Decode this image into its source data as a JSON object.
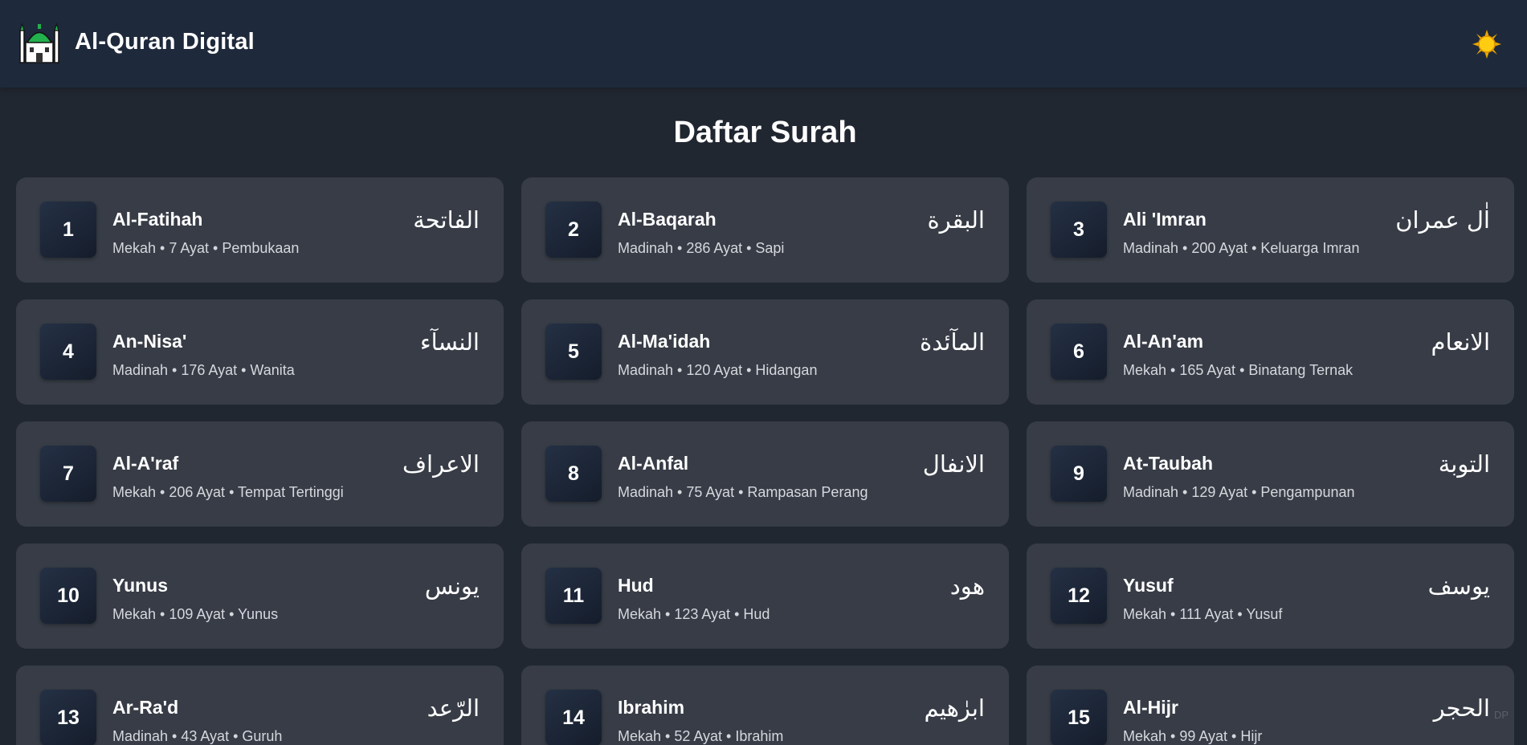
{
  "header": {
    "app_title": "Al-Quran Digital",
    "logo_icon": "mosque-icon",
    "theme_icon": "sun-icon"
  },
  "main": {
    "page_title": "Daftar Surah",
    "corner_mark": "DP"
  },
  "surahs": [
    {
      "number": "1",
      "name": "Al-Fatihah",
      "meta": "Mekah • 7 Ayat • Pembukaan",
      "arabic": "الفاتحة"
    },
    {
      "number": "2",
      "name": "Al-Baqarah",
      "meta": "Madinah • 286 Ayat • Sapi",
      "arabic": "البقرة"
    },
    {
      "number": "3",
      "name": "Ali 'Imran",
      "meta": "Madinah • 200 Ayat • Keluarga Imran",
      "arabic": "اٰل عمران"
    },
    {
      "number": "4",
      "name": "An-Nisa'",
      "meta": "Madinah • 176 Ayat • Wanita",
      "arabic": "النسآء"
    },
    {
      "number": "5",
      "name": "Al-Ma'idah",
      "meta": "Madinah • 120 Ayat • Hidangan",
      "arabic": "المآئدة"
    },
    {
      "number": "6",
      "name": "Al-An'am",
      "meta": "Mekah • 165 Ayat • Binatang Ternak",
      "arabic": "الانعام"
    },
    {
      "number": "7",
      "name": "Al-A'raf",
      "meta": "Mekah • 206 Ayat • Tempat Tertinggi",
      "arabic": "الاعراف"
    },
    {
      "number": "8",
      "name": "Al-Anfal",
      "meta": "Madinah • 75 Ayat • Rampasan Perang",
      "arabic": "الانفال"
    },
    {
      "number": "9",
      "name": "At-Taubah",
      "meta": "Madinah • 129 Ayat • Pengampunan",
      "arabic": "التوبة"
    },
    {
      "number": "10",
      "name": "Yunus",
      "meta": "Mekah • 109 Ayat • Yunus",
      "arabic": "يونس"
    },
    {
      "number": "11",
      "name": "Hud",
      "meta": "Mekah • 123 Ayat • Hud",
      "arabic": "هود"
    },
    {
      "number": "12",
      "name": "Yusuf",
      "meta": "Mekah • 111 Ayat • Yusuf",
      "arabic": "يوسف"
    },
    {
      "number": "13",
      "name": "Ar-Ra'd",
      "meta": "Madinah • 43 Ayat • Guruh",
      "arabic": "الرّعد"
    },
    {
      "number": "14",
      "name": "Ibrahim",
      "meta": "Mekah • 52 Ayat • Ibrahim",
      "arabic": "ابرٰهيم"
    },
    {
      "number": "15",
      "name": "Al-Hijr",
      "meta": "Mekah • 99 Ayat • Hijr",
      "arabic": "الحجر"
    }
  ]
}
